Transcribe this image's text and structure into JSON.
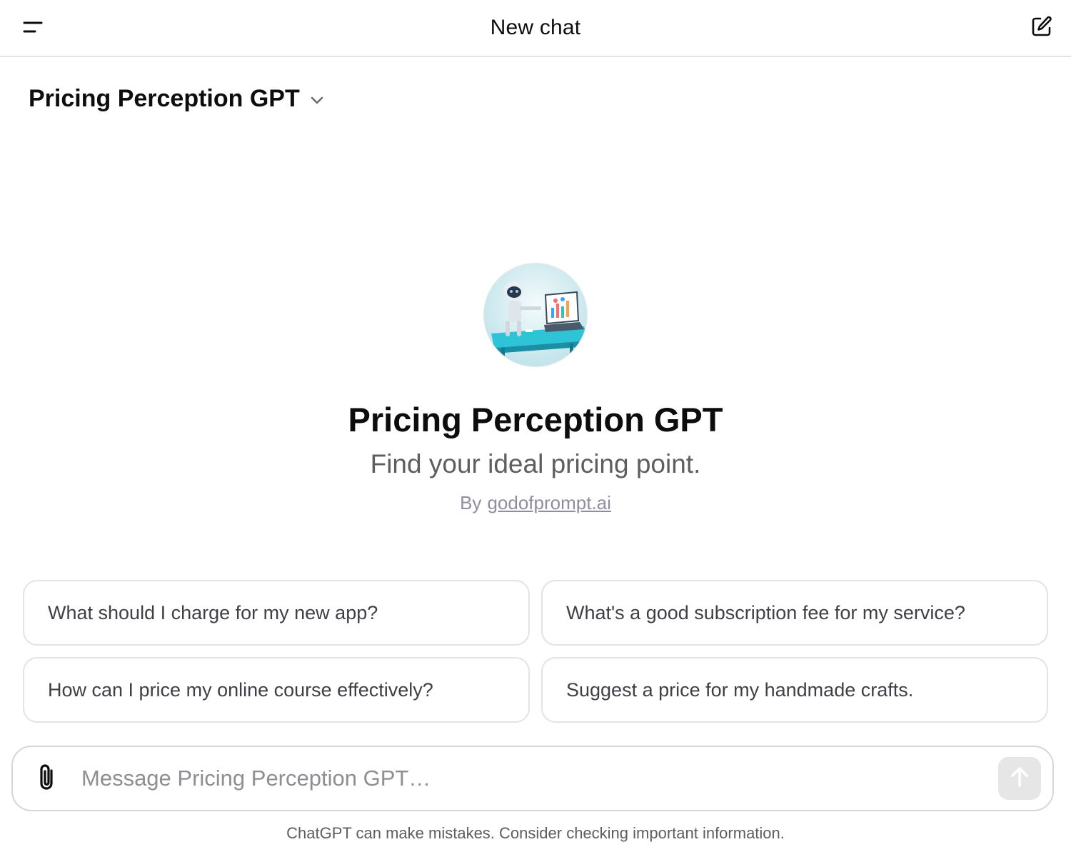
{
  "header": {
    "title": "New chat",
    "menu_icon": "menu-icon",
    "compose_icon": "new-chat-icon"
  },
  "gpt_selector": {
    "label": "Pricing Perception GPT",
    "icon": "chevron-down-icon"
  },
  "hero": {
    "title": "Pricing Perception GPT",
    "description": "Find your ideal pricing point.",
    "by_prefix": "By",
    "author": "godofprompt.ai"
  },
  "prompts": [
    "What should I charge for my new app?",
    "What's a good subscription fee for my service?",
    "How can I price my online course effectively?",
    "Suggest a price for my handmade crafts."
  ],
  "composer": {
    "placeholder": "Message Pricing Perception GPT…",
    "attach_icon": "paperclip-icon",
    "send_icon": "arrow-up-icon"
  },
  "footer": {
    "disclaimer": "ChatGPT can make mistakes. Consider checking important information."
  },
  "colors": {
    "border": "#e3e3e3",
    "muted_text": "#5d5d62",
    "send_button_disabled": "#e6e6e6"
  }
}
